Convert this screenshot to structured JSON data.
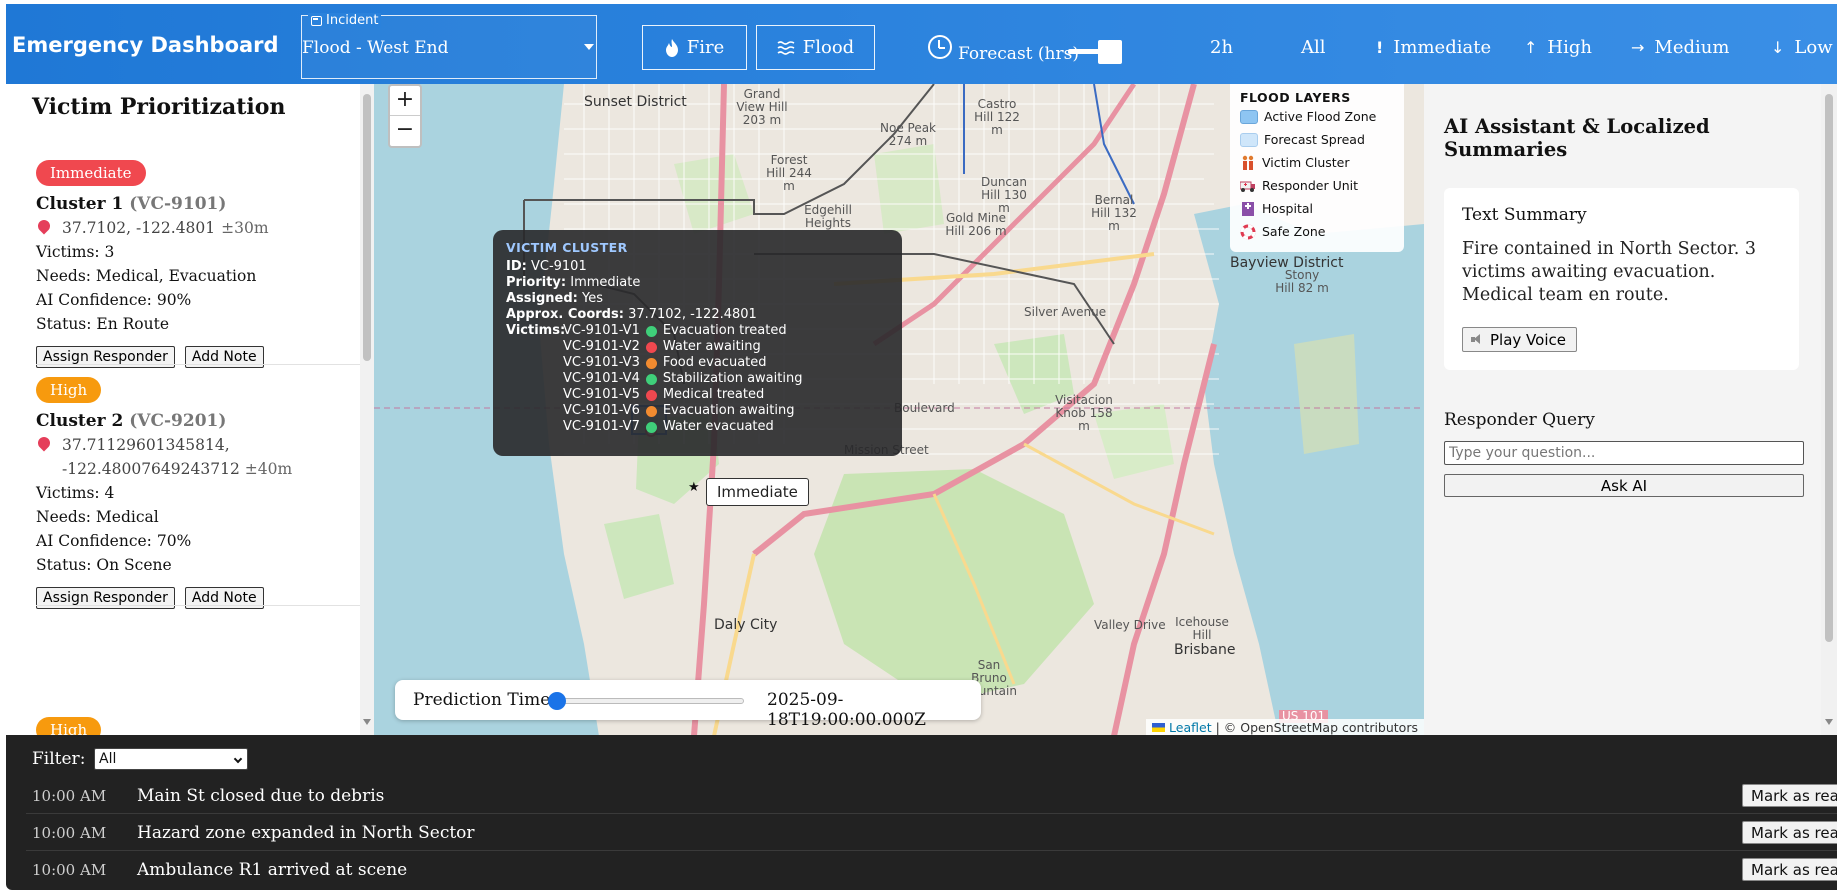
{
  "header": {
    "title": "Emergency Dashboard",
    "incident_legend": "Incident",
    "incident_value": "Flood - West End",
    "fire_label": "Fire",
    "flood_label": "Flood",
    "forecast_label": "Forecast (hrs)",
    "forecast_slider_fraction": 1.0,
    "time_label": "2h",
    "all_label": "All",
    "priority_filters": [
      {
        "label": "Immediate",
        "icon": "exclamation-icon"
      },
      {
        "label": "High",
        "icon": "arrow-up-icon"
      },
      {
        "label": "Medium",
        "icon": "arrow-right-icon"
      },
      {
        "label": "Low",
        "icon": "arrow-down-icon"
      }
    ],
    "colors": {
      "bar_start": "#1f78d6",
      "bar_end": "#3a8fe6"
    }
  },
  "left": {
    "title": "Victim Prioritization",
    "clusters": [
      {
        "priority": "Immediate",
        "priority_color": "#f0484f",
        "name": "Cluster 1",
        "id": "(VC-9101)",
        "coords": "37.7102, -122.4801",
        "accuracy": "±30m",
        "victims": "Victims: 3",
        "needs": "Needs: Medical, Evacuation",
        "confidence": "AI Confidence: 90%",
        "status": "Status: En Route",
        "assign_label": "Assign Responder",
        "note_label": "Add Note"
      },
      {
        "priority": "High",
        "priority_color": "#f79a0e",
        "name": "Cluster 2",
        "id": "(VC-9201)",
        "coords": "37.71129601345814, -122.48007649243712",
        "accuracy": "±40m",
        "victims": "Victims: 4",
        "needs": "Needs: Medical",
        "confidence": "AI Confidence: 70%",
        "status": "Status: On Scene",
        "assign_label": "Assign Responder",
        "note_label": "Add Note"
      },
      {
        "priority": "High",
        "priority_color": "#f79a0e"
      }
    ]
  },
  "map": {
    "zoom_in": "+",
    "zoom_out": "−",
    "legend": {
      "title": "FLOOD LAYERS",
      "items": [
        {
          "label": "Active Flood Zone",
          "icon": "active-flood-swatch",
          "color": "#8ec5f2"
        },
        {
          "label": "Forecast Spread",
          "icon": "forecast-spread-swatch",
          "color": "#cfe6fa"
        },
        {
          "label": "Victim Cluster",
          "icon": "victim-cluster-icon"
        },
        {
          "label": "Responder Unit",
          "icon": "ambulance-icon"
        },
        {
          "label": "Hospital",
          "icon": "hospital-icon"
        },
        {
          "label": "Safe Zone",
          "icon": "lifebuoy-icon"
        }
      ]
    },
    "labels": [
      {
        "text": "Sunset District"
      },
      {
        "text": "Grand View Hill 203 m"
      },
      {
        "text": "Forest Hill 244 m"
      },
      {
        "text": "Edgehill Heights"
      },
      {
        "text": "Noe Peak 274 m"
      },
      {
        "text": "Castro Hill 122 m"
      },
      {
        "text": "Duncan Hill 130 m"
      },
      {
        "text": "Gold Mine Hill 206 m"
      },
      {
        "text": "Bernal Hill 132 m"
      },
      {
        "text": "Bayview District"
      },
      {
        "text": "Stony Hill 82 m"
      },
      {
        "text": "Silver Avenue"
      },
      {
        "text": "Visitacion Knob 158 m"
      },
      {
        "text": "Daly City"
      },
      {
        "text": "Brisbane"
      },
      {
        "text": "Icehouse Hill"
      },
      {
        "text": "Valley Drive"
      },
      {
        "text": "San Bruno Mountain"
      },
      {
        "text": "Mission Street"
      },
      {
        "text": "Boulevard"
      },
      {
        "text": "US 101"
      }
    ],
    "tooltip": {
      "title": "VICTIM CLUSTER",
      "id_label": "ID:",
      "id_value": "VC-9101",
      "priority_label": "Priority:",
      "priority_value": "Immediate",
      "assigned_label": "Assigned:",
      "assigned_value": "Yes",
      "coords_label": "Approx. Coords:",
      "coords_value": "37.7102, -122.4801",
      "victims_label": "Victims:",
      "victims": [
        {
          "id": "VC-9101-V1",
          "status": "Evacuation treated",
          "color": "#3fcf7a"
        },
        {
          "id": "VC-9101-V2",
          "status": "Water awaiting",
          "color": "#f0484f"
        },
        {
          "id": "VC-9101-V3",
          "status": "Food evacuated",
          "color": "#f28b30"
        },
        {
          "id": "VC-9101-V4",
          "status": "Stabilization awaiting",
          "color": "#3fcf7a"
        },
        {
          "id": "VC-9101-V5",
          "status": "Medical treated",
          "color": "#f0484f"
        },
        {
          "id": "VC-9101-V6",
          "status": "Evacuation awaiting",
          "color": "#f28b30"
        },
        {
          "id": "VC-9101-V7",
          "status": "Water evacuated",
          "color": "#3fcf7a"
        }
      ]
    },
    "marker_label": "Immediate",
    "prediction": {
      "label": "Prediction Time:",
      "value": "2025-09-18T19:00:00.000Z",
      "slider_fraction": 0.0
    },
    "attribution": {
      "link": "Leaflet",
      "text": "| © OpenStreetMap contributors"
    }
  },
  "right": {
    "title": "AI Assistant & Localized Summaries",
    "summary_title": "Text Summary",
    "summary_text": "Fire contained in North Sector. 3 victims awaiting evacuation. Medical team en route.",
    "play_voice": "Play Voice",
    "query_title": "Responder Query",
    "query_placeholder": "Type your question...",
    "ask_label": "Ask AI"
  },
  "feed": {
    "filter_label": "Filter:",
    "filter_value": "All",
    "items": [
      {
        "time": "10:00 AM",
        "message": "Main St closed due to debris",
        "action": "Mark as read"
      },
      {
        "time": "10:00 AM",
        "message": "Hazard zone expanded in North Sector",
        "action": "Mark as read"
      },
      {
        "time": "10:00 AM",
        "message": "Ambulance R1 arrived at scene",
        "action": "Mark as read"
      }
    ]
  }
}
